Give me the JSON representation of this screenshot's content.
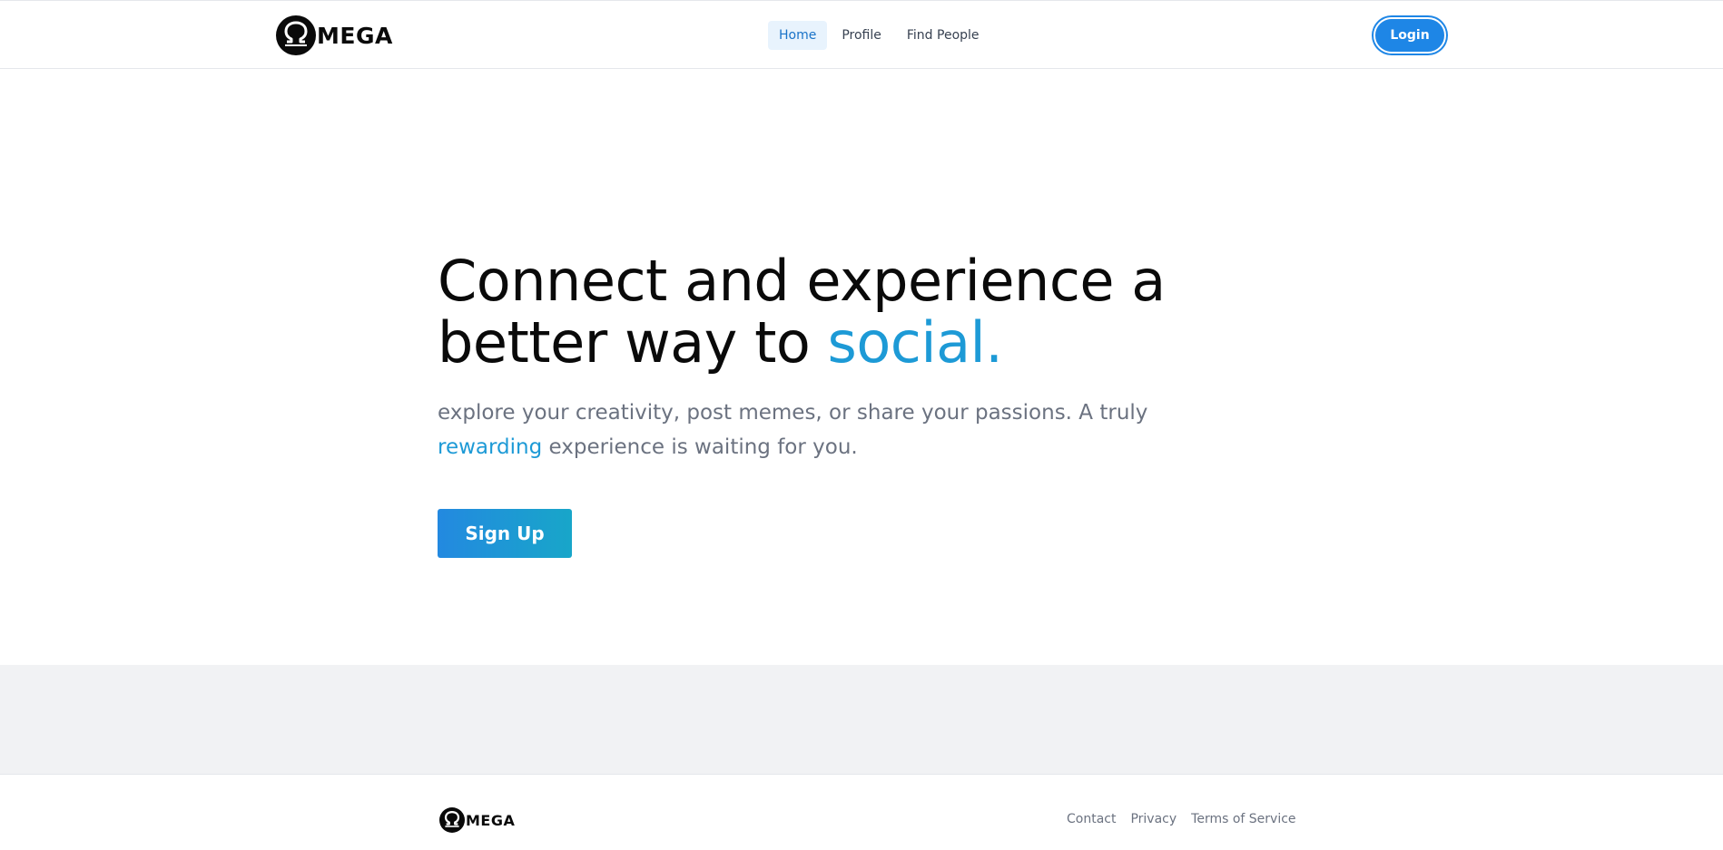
{
  "brand": {
    "name": "MEGA",
    "logo_icon": "omega-icon"
  },
  "nav": {
    "items": [
      {
        "label": "Home",
        "active": true
      },
      {
        "label": "Profile",
        "active": false
      },
      {
        "label": "Find People",
        "active": false
      }
    ]
  },
  "header": {
    "login_label": "Login"
  },
  "hero": {
    "title_line1": "Connect and experience a",
    "title_line2_prefix": "better way to ",
    "title_accent": "social.",
    "subtitle_before": "explore your creativity, post memes, or share your passions. A truly ",
    "subtitle_accent": "rewarding",
    "subtitle_after": " experience is waiting for you.",
    "signup_label": "Sign Up"
  },
  "footer": {
    "brand_name": "MEGA",
    "links": [
      "Contact",
      "Privacy",
      "Terms of Service"
    ]
  },
  "colors": {
    "accent": "#1d9ad6",
    "primary_button": "#1e86e6",
    "nav_active_bg": "#e8f3fd",
    "nav_active_text": "#1a73c8",
    "band_gray": "#f1f2f4"
  }
}
